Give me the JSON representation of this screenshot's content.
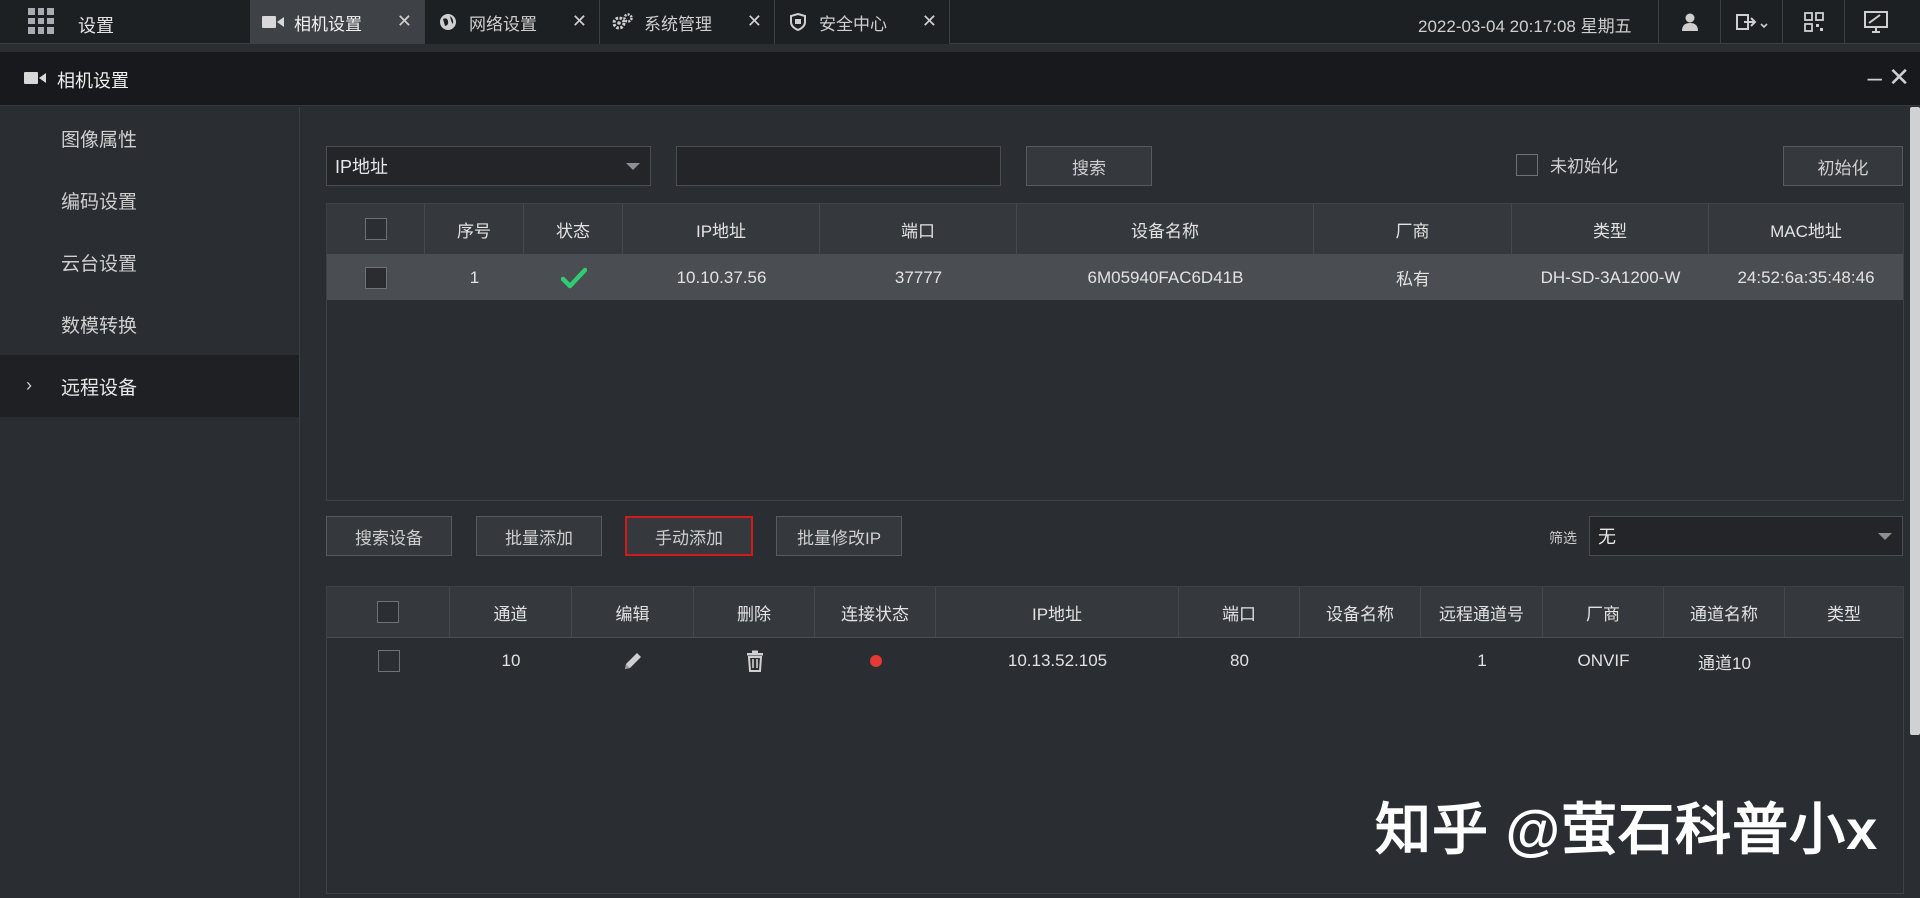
{
  "topbar": {
    "app_title": "设置",
    "tabs": [
      {
        "label": "相机设置",
        "icon": "camera-icon",
        "close": "✕"
      },
      {
        "label": "网络设置",
        "icon": "globe-icon",
        "close": "✕"
      },
      {
        "label": "系统管理",
        "icon": "gears-icon",
        "close": "✕"
      },
      {
        "label": "安全中心",
        "icon": "shield-icon",
        "close": "✕"
      }
    ],
    "datetime": "2022-03-04 20:17:08 星期五"
  },
  "window": {
    "title": "相机设置",
    "minimize": "–",
    "close": "✕"
  },
  "sidebar": {
    "items": [
      {
        "label": "图像属性"
      },
      {
        "label": "编码设置"
      },
      {
        "label": "云台设置"
      },
      {
        "label": "数模转换"
      },
      {
        "label": "远程设备",
        "active": true
      }
    ],
    "chevron": "›"
  },
  "search_bar": {
    "type_select": "IP地址",
    "search_value": "",
    "search_button": "搜索",
    "uninit_label": "未初始化",
    "init_button": "初始化"
  },
  "device_table": {
    "columns": [
      "序号",
      "状态",
      "IP地址",
      "端口",
      "设备名称",
      "厂商",
      "类型",
      "MAC地址"
    ],
    "rows": [
      {
        "index": "1",
        "status": "ok",
        "ip": "10.10.37.56",
        "port": "37777",
        "name": "6M05940FAC6D41B",
        "vendor": "私有",
        "type": "DH-SD-3A1200-W",
        "mac": "24:52:6a:35:48:46"
      }
    ]
  },
  "actions": {
    "search_device": "搜索设备",
    "batch_add": "批量添加",
    "manual_add": "手动添加",
    "batch_modify_ip": "批量修改IP",
    "filter_label": "筛选",
    "filter_value": "无"
  },
  "added_table": {
    "columns": [
      "通道",
      "编辑",
      "删除",
      "连接状态",
      "IP地址",
      "端口",
      "设备名称",
      "远程通道号",
      "厂商",
      "通道名称",
      "类型"
    ],
    "rows": [
      {
        "channel": "10",
        "ip": "10.13.52.105",
        "port": "80",
        "name": "",
        "remote_channel": "1",
        "vendor": "ONVIF",
        "channel_name": "通道10",
        "type": ""
      }
    ]
  },
  "watermark": "知乎 @萤石科普小x",
  "colors": {
    "status_ok": "#2fcc71",
    "status_disconnected": "#e53935",
    "highlight_border": "#d11a1a"
  }
}
